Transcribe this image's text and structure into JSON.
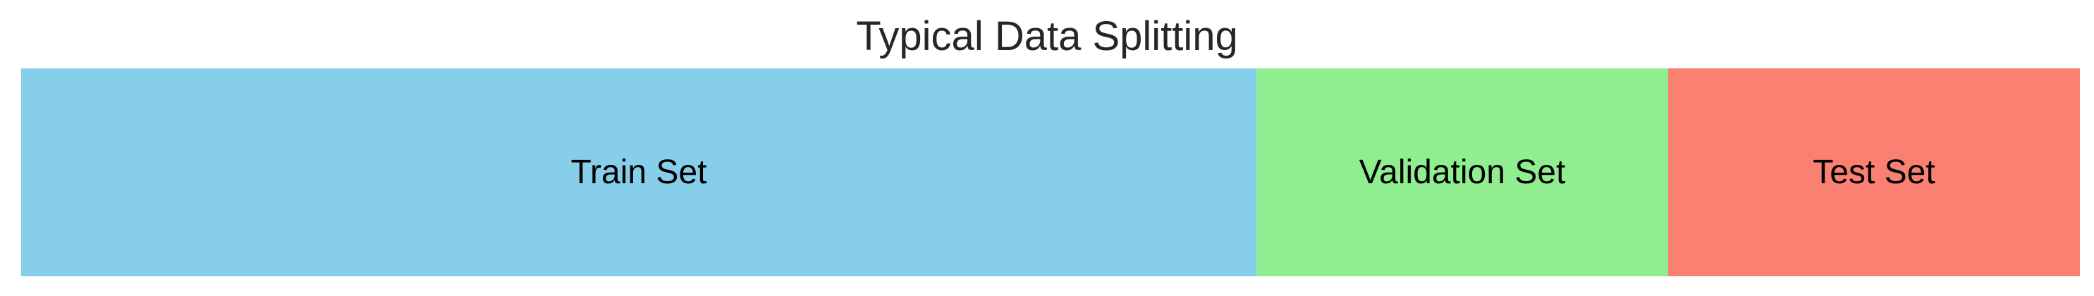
{
  "chart_data": {
    "type": "bar",
    "orientation": "horizontal-stacked",
    "title": "Typical Data Splitting",
    "categories": [
      "Train Set",
      "Validation Set",
      "Test Set"
    ],
    "values": [
      60,
      20,
      20
    ],
    "colors": [
      "#87CEEB",
      "#90EE90",
      "#FA8072"
    ],
    "xlabel": "",
    "ylabel": "",
    "xlim": [
      0,
      100
    ],
    "grid": false,
    "legend": "none"
  }
}
